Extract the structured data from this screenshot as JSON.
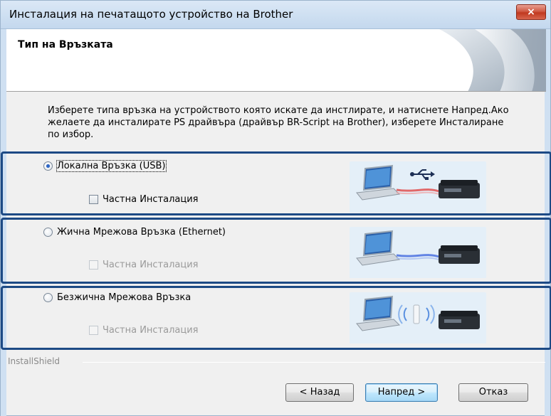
{
  "window": {
    "title": "Инсталация на печатащото устройство на Brother",
    "close_label": "×"
  },
  "header": {
    "title": "Тип на Връзката"
  },
  "description": "Изберете типа връзка на устройството която искате да инстлирате, и натиснете Напред.Ако желаете да инсталирате PS драйвъра (драйвър BR-Script на Brother), изберете Инсталиране по избор.",
  "options": [
    {
      "label": "Локална Връзка (USB)",
      "checked": true,
      "custom_label": "Частна Инсталация",
      "custom_enabled": true
    },
    {
      "label": "Жична Мрежова Връзка (Ethernet)",
      "checked": false,
      "custom_label": "Частна Инсталация",
      "custom_enabled": false
    },
    {
      "label": "Безжична Мрежова Връзка",
      "checked": false,
      "custom_label": "Частна Инсталация",
      "custom_enabled": false
    }
  ],
  "footer": {
    "installshield": "InstallShield",
    "back_label": "< Назад",
    "next_label": "Напред >",
    "cancel_label": "Отказ"
  },
  "colors": {
    "frame": "#1d4a85",
    "usb_cable": "#e05050",
    "ethernet_cable": "#4a70e0",
    "accent": "#3c7fb1"
  }
}
